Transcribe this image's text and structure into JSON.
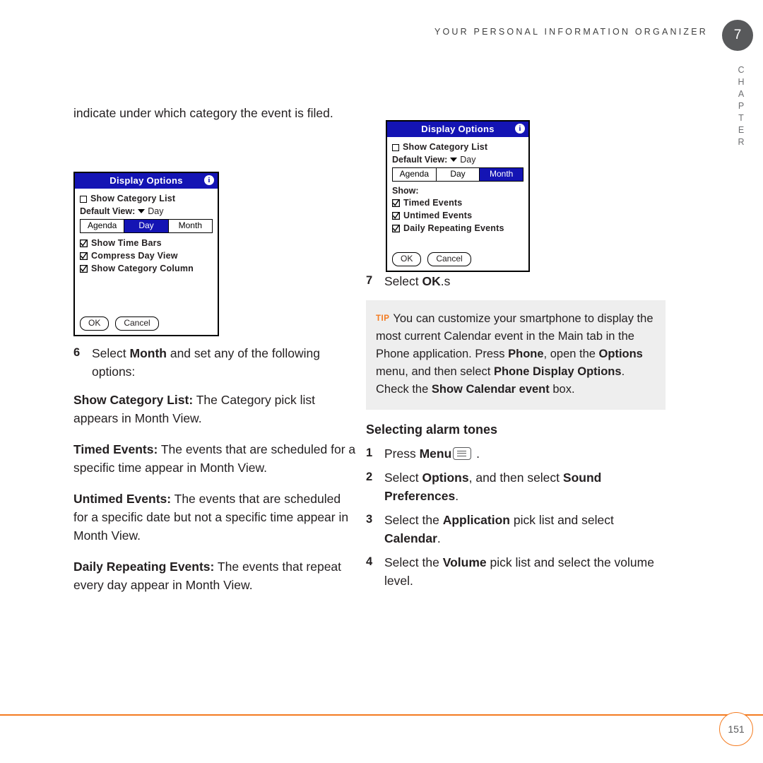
{
  "header": {
    "running_title": "YOUR PERSONAL INFORMATION ORGANIZER",
    "chapter_number": "7",
    "chapter_word": "CHAPTER"
  },
  "left_column": {
    "intro_paragraph": "indicate under which category the event is filed.",
    "step6": {
      "number": "6",
      "text_before": "Select ",
      "bold": "Month",
      "text_after": " and set any of the following options:"
    },
    "definitions": [
      {
        "term": "Show Category List:",
        "text": " The Category pick list appears in Month View."
      },
      {
        "term": "Timed Events:",
        "text": " The events that are scheduled for a specific time appear in Month View."
      },
      {
        "term": "Untimed Events:",
        "text": " The events that are scheduled for a specific date but not a specific time appear in Month View."
      },
      {
        "term": "Daily Repeating Events:",
        "text": " The events that repeat every day appear in Month View."
      }
    ]
  },
  "palm_left": {
    "title": "Display Options",
    "info_icon": "info-icon",
    "checkbox_row": "Show Category List",
    "default_view_label": "Default View:",
    "default_view_value": "Day",
    "tabs": [
      "Agenda",
      "Day",
      "Month"
    ],
    "active_tab": "Day",
    "checked_rows": [
      "Show Time Bars",
      "Compress Day View",
      "Show Category Column"
    ],
    "buttons": [
      "OK",
      "Cancel"
    ]
  },
  "palm_right": {
    "title": "Display Options",
    "info_icon": "info-icon",
    "checkbox_row": "Show Category List",
    "default_view_label": "Default View:",
    "default_view_value": "Day",
    "tabs": [
      "Agenda",
      "Day",
      "Month"
    ],
    "active_tab": "Month",
    "show_label": "Show:",
    "checked_rows": [
      "Timed Events",
      "Untimed Events",
      "Daily Repeating Events"
    ],
    "buttons": [
      "OK",
      "Cancel"
    ]
  },
  "right_column": {
    "step7": {
      "number": "7",
      "text_before": "Select ",
      "bold": "OK",
      "text_after": ".s"
    },
    "tip": {
      "label": "TIP",
      "segments": [
        {
          "text": "You can customize your smartphone to display the most current Calendar event in the Main tab in the Phone application. Press ",
          "bold": false
        },
        {
          "text": "Phone",
          "bold": true
        },
        {
          "text": ", open the ",
          "bold": false
        },
        {
          "text": "Options",
          "bold": true
        },
        {
          "text": " menu, and then select ",
          "bold": false
        },
        {
          "text": "Phone Display Options",
          "bold": true
        },
        {
          "text": ". Check the ",
          "bold": false
        },
        {
          "text": "Show Calendar event",
          "bold": true
        },
        {
          "text": " box.",
          "bold": false
        }
      ]
    },
    "section_heading": "Selecting alarm tones",
    "steps": [
      {
        "number": "1",
        "segments": [
          {
            "text": "Press ",
            "bold": false
          },
          {
            "text": "Menu",
            "bold": true
          },
          {
            "text": " ",
            "bold": false
          },
          {
            "text": "menu-key-icon",
            "icon": true
          },
          {
            "text": " .",
            "bold": false
          }
        ]
      },
      {
        "number": "2",
        "segments": [
          {
            "text": "Select ",
            "bold": false
          },
          {
            "text": "Options",
            "bold": true
          },
          {
            "text": ", and then select ",
            "bold": false
          },
          {
            "text": "Sound Preferences",
            "bold": true
          },
          {
            "text": ".",
            "bold": false
          }
        ]
      },
      {
        "number": "3",
        "segments": [
          {
            "text": "Select the ",
            "bold": false
          },
          {
            "text": "Application",
            "bold": true
          },
          {
            "text": " pick list and select ",
            "bold": false
          },
          {
            "text": "Calendar",
            "bold": true
          },
          {
            "text": ".",
            "bold": false
          }
        ]
      },
      {
        "number": "4",
        "segments": [
          {
            "text": "Select the ",
            "bold": false
          },
          {
            "text": "Volume",
            "bold": true
          },
          {
            "text": " pick list and select the volume level.",
            "bold": false
          }
        ]
      }
    ]
  },
  "footer": {
    "page_number": "151",
    "rule_color": "#f47b20"
  }
}
